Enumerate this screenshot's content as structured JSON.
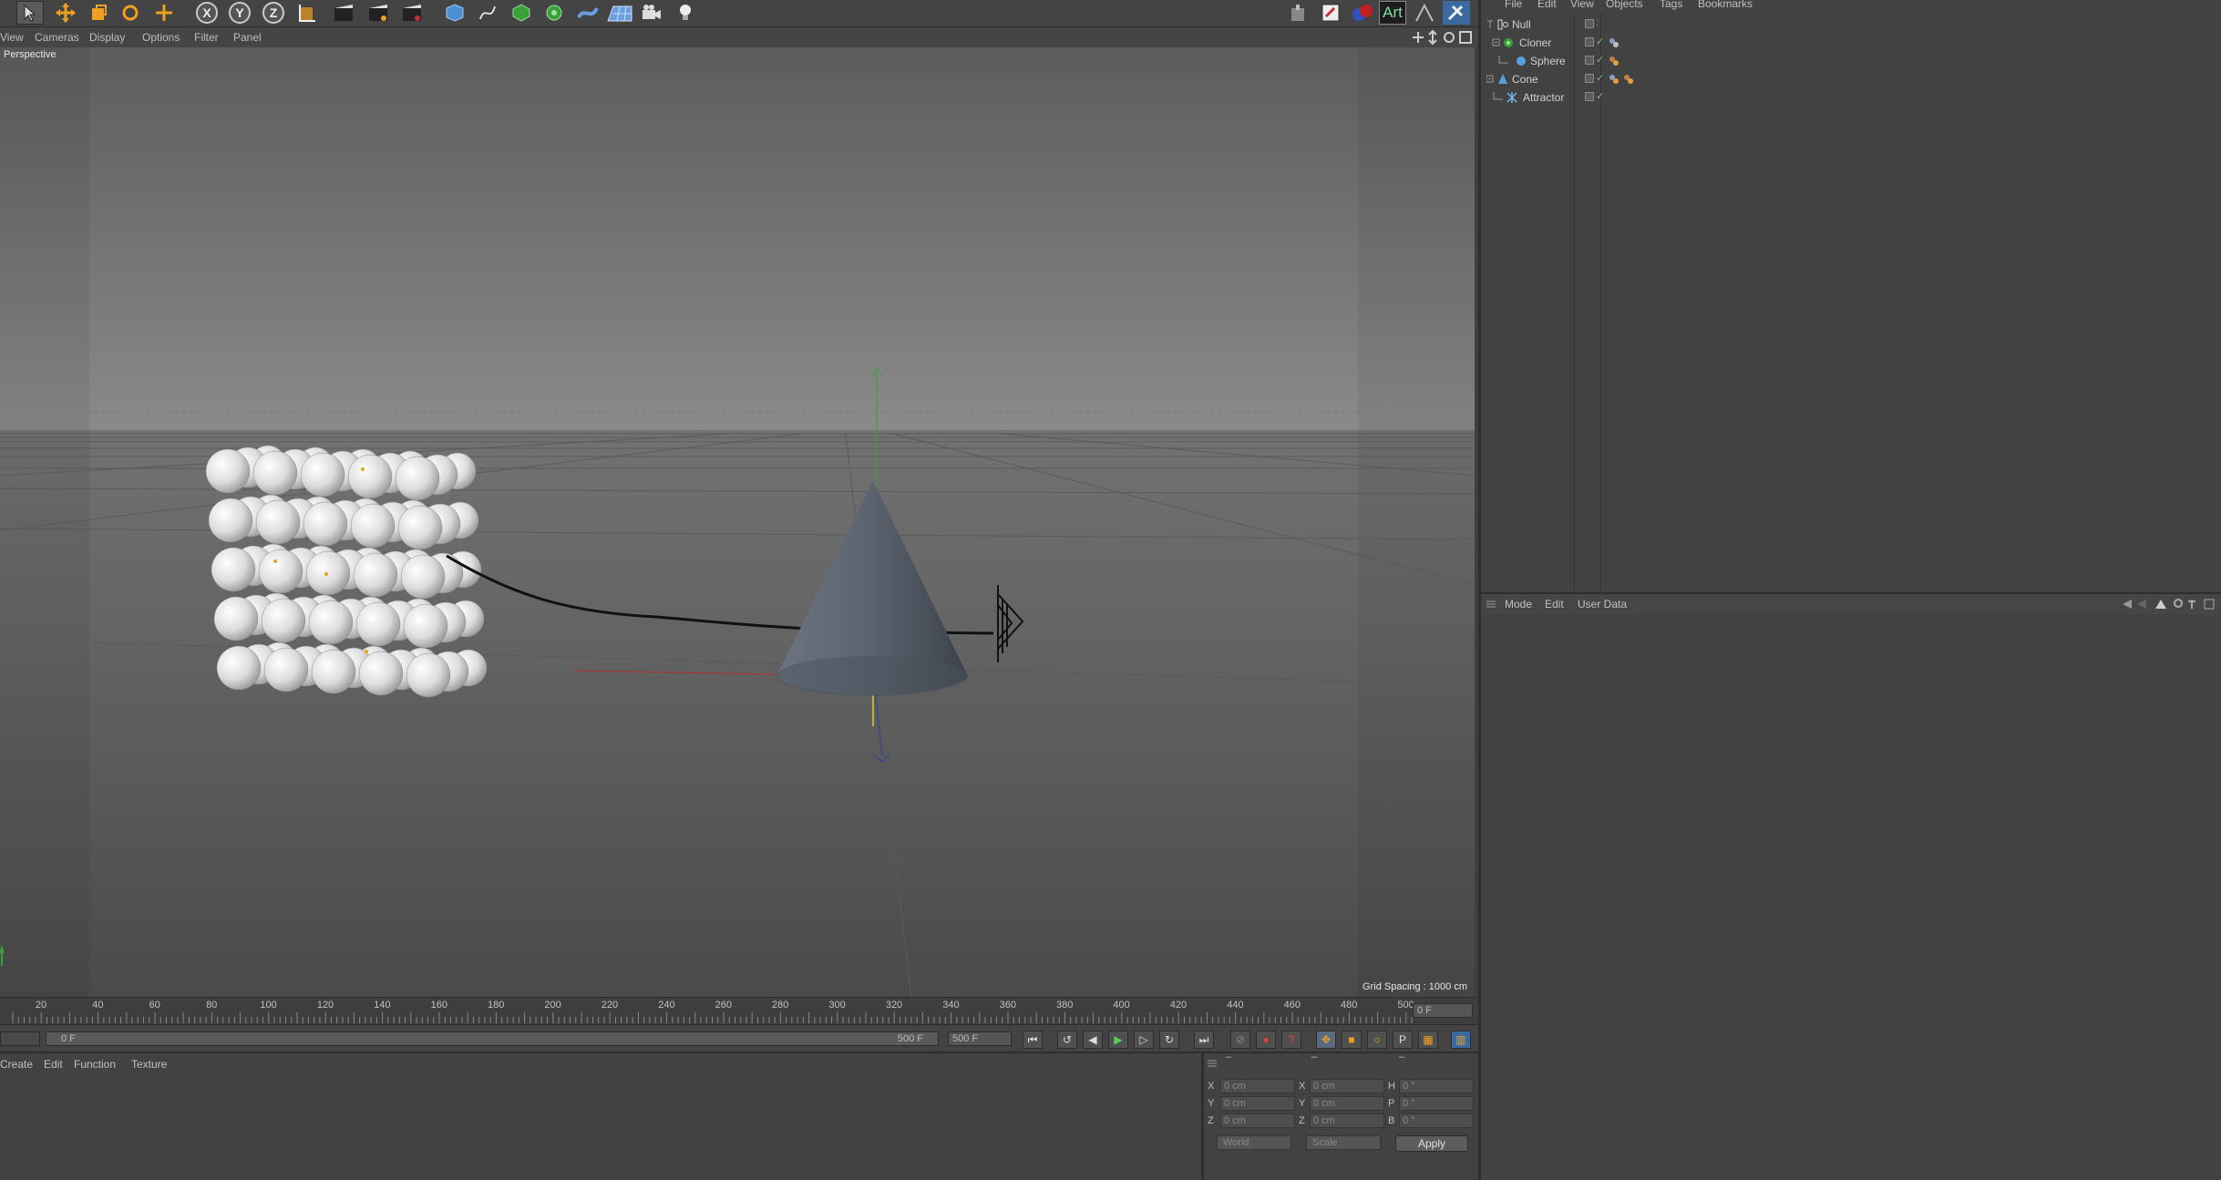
{
  "viewport": {
    "menu": [
      "View",
      "Cameras",
      "Display",
      "Options",
      "Filter",
      "Panel"
    ],
    "camera_label": "Perspective",
    "grid_spacing": "Grid Spacing : 1000 cm"
  },
  "object_manager": {
    "menu": [
      "File",
      "Edit",
      "View",
      "Objects",
      "Tags",
      "Bookmarks"
    ],
    "objects": [
      {
        "name": "Null",
        "icon": "null-icon"
      },
      {
        "name": "Cloner",
        "icon": "cloner-icon"
      },
      {
        "name": "Sphere",
        "icon": "sphere-icon"
      },
      {
        "name": "Cone",
        "icon": "cone-icon"
      },
      {
        "name": "Attractor",
        "icon": "attractor-icon"
      }
    ]
  },
  "attributes": {
    "menu": [
      "Mode",
      "Edit",
      "User Data"
    ]
  },
  "timeline": {
    "ticks": [
      "20",
      "40",
      "60",
      "80",
      "100",
      "120",
      "140",
      "160",
      "180",
      "200",
      "220",
      "240",
      "260",
      "280",
      "300",
      "320",
      "340",
      "360",
      "380",
      "400",
      "420",
      "440",
      "460",
      "480",
      "500"
    ],
    "current_frame": "0 F",
    "range_start": "0 F",
    "range_end_slider": "500 F",
    "range_end": "500 F"
  },
  "material_manager": {
    "menu": [
      "Create",
      "Edit",
      "Function",
      "Texture"
    ]
  },
  "coordinates": {
    "position": {
      "x": "0 cm",
      "y": "0 cm",
      "z": "0 cm"
    },
    "size": {
      "x": "0 cm",
      "y": "0 cm",
      "z": "0 cm"
    },
    "rotation": {
      "h": "0 °",
      "p": "0 °",
      "b": "0 °"
    },
    "labels": {
      "x": "X",
      "y": "Y",
      "z": "Z",
      "h": "H",
      "p": "P",
      "b": "B"
    },
    "mode_dropdown": "World",
    "scale_dropdown": "Scale",
    "apply_label": "Apply"
  },
  "toolbar": {
    "icons": [
      "select-icon",
      "move-icon",
      "scale-icon",
      "rotate-icon",
      "live-select-icon",
      "x-axis-icon",
      "y-axis-icon",
      "z-axis-icon",
      "coordinate-system-icon",
      "render-view-icon",
      "render-picture-viewer-icon",
      "render-settings-icon",
      "cube-icon",
      "spline-icon",
      "nurbs-icon",
      "array-icon",
      "deformer-icon",
      "floor-icon",
      "camera-icon",
      "light-icon"
    ],
    "axis_labels": {
      "x": "X",
      "y": "Y",
      "z": "Z"
    },
    "art_label": "Art"
  },
  "colors": {
    "accent_orange": "#f0a020",
    "axis_x": "#b03030",
    "axis_y": "#3aa03a",
    "axis_z": "#3040a0"
  }
}
